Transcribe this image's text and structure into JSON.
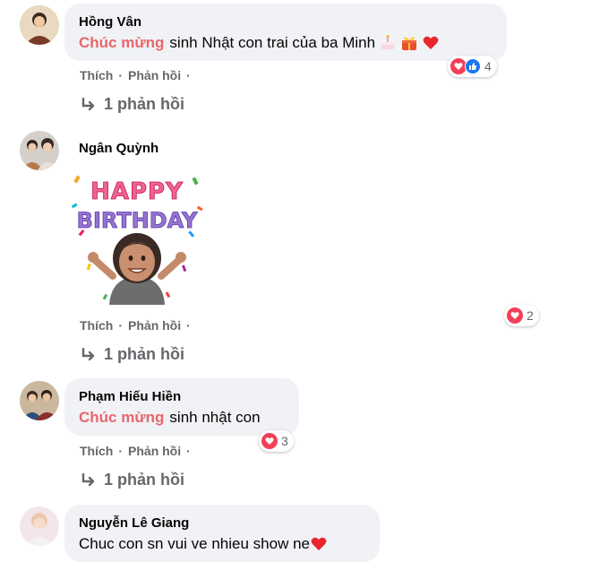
{
  "comments": [
    {
      "author": "Hồng Vân",
      "highlight": "Chúc mừng",
      "text": "sinh Nhật con trai của ba Minh",
      "actions": {
        "like": "Thích",
        "reply": "Phản hồi",
        "sep": "·"
      },
      "reaction_count": "4",
      "replies_label": "1 phản hồi"
    },
    {
      "author": "Ngân Quỳnh",
      "sticker": {
        "line1": "HAPPY",
        "line2": "BIRTHDAY"
      },
      "actions": {
        "like": "Thích",
        "reply": "Phản hồi",
        "sep": "·"
      },
      "reaction_count": "2",
      "replies_label": "1 phản hồi"
    },
    {
      "author": "Phạm Hiếu Hiền",
      "highlight": "Chúc mừng",
      "text": "sinh nhật con",
      "actions": {
        "like": "Thích",
        "reply": "Phản hồi",
        "sep": "·"
      },
      "reaction_count": "3",
      "replies_label": "1 phản hồi"
    },
    {
      "author": "Nguyễn Lê Giang",
      "text": "Chuc con sn vui ve nhieu show ne"
    }
  ],
  "colors": {
    "bubble": "#f0f2f5",
    "highlight": "#e9666c",
    "meta": "#65676b",
    "heart": "#f33e58",
    "like": "#1877f2"
  }
}
